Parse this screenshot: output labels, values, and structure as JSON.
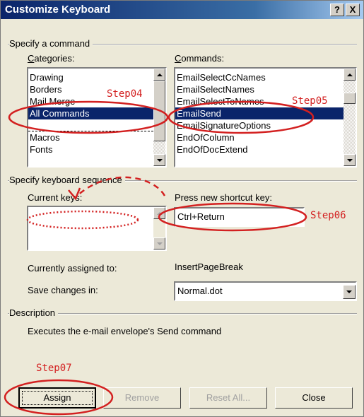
{
  "window": {
    "title": "Customize Keyboard",
    "help_btn": "?",
    "close_btn": "X"
  },
  "specify_command": {
    "group_label": "Specify a command",
    "categories_label": "Categories:",
    "categories": [
      "Drawing",
      "Borders",
      "Mail Merge",
      "All Commands",
      "---",
      "Macros",
      "Fonts"
    ],
    "commands_label": "Commands:",
    "commands": [
      "EmailSelectCcNames",
      "EmailSelectNames",
      "EmailSelectToNames",
      "EmailSend",
      "EmailSignatureOptions",
      "EndOfColumn",
      "EndOfDocExtend"
    ]
  },
  "keyboard_sequence": {
    "group_label": "Specify keyboard sequence",
    "current_keys_label": "Current keys:",
    "new_shortcut_label": "Press new shortcut key:",
    "new_shortcut_value": "Ctrl+Return",
    "assigned_label": "Currently assigned to:",
    "assigned_value": "InsertPageBreak",
    "save_label": "Save changes in:",
    "save_value": "Normal.dot"
  },
  "description": {
    "group_label": "Description",
    "text": "Executes the e-mail envelope's Send command"
  },
  "buttons": {
    "assign": "Assign",
    "remove": "Remove",
    "reset_all": "Reset All...",
    "close": "Close"
  },
  "annotations": {
    "step04": "Step04",
    "step05": "Step05",
    "step06": "Step06",
    "step07": "Step07",
    "color": "#d32020"
  },
  "colors": {
    "dialog_bg": "#ece9d8",
    "selection": "#0a246a",
    "titlebar": "#0a246a"
  }
}
